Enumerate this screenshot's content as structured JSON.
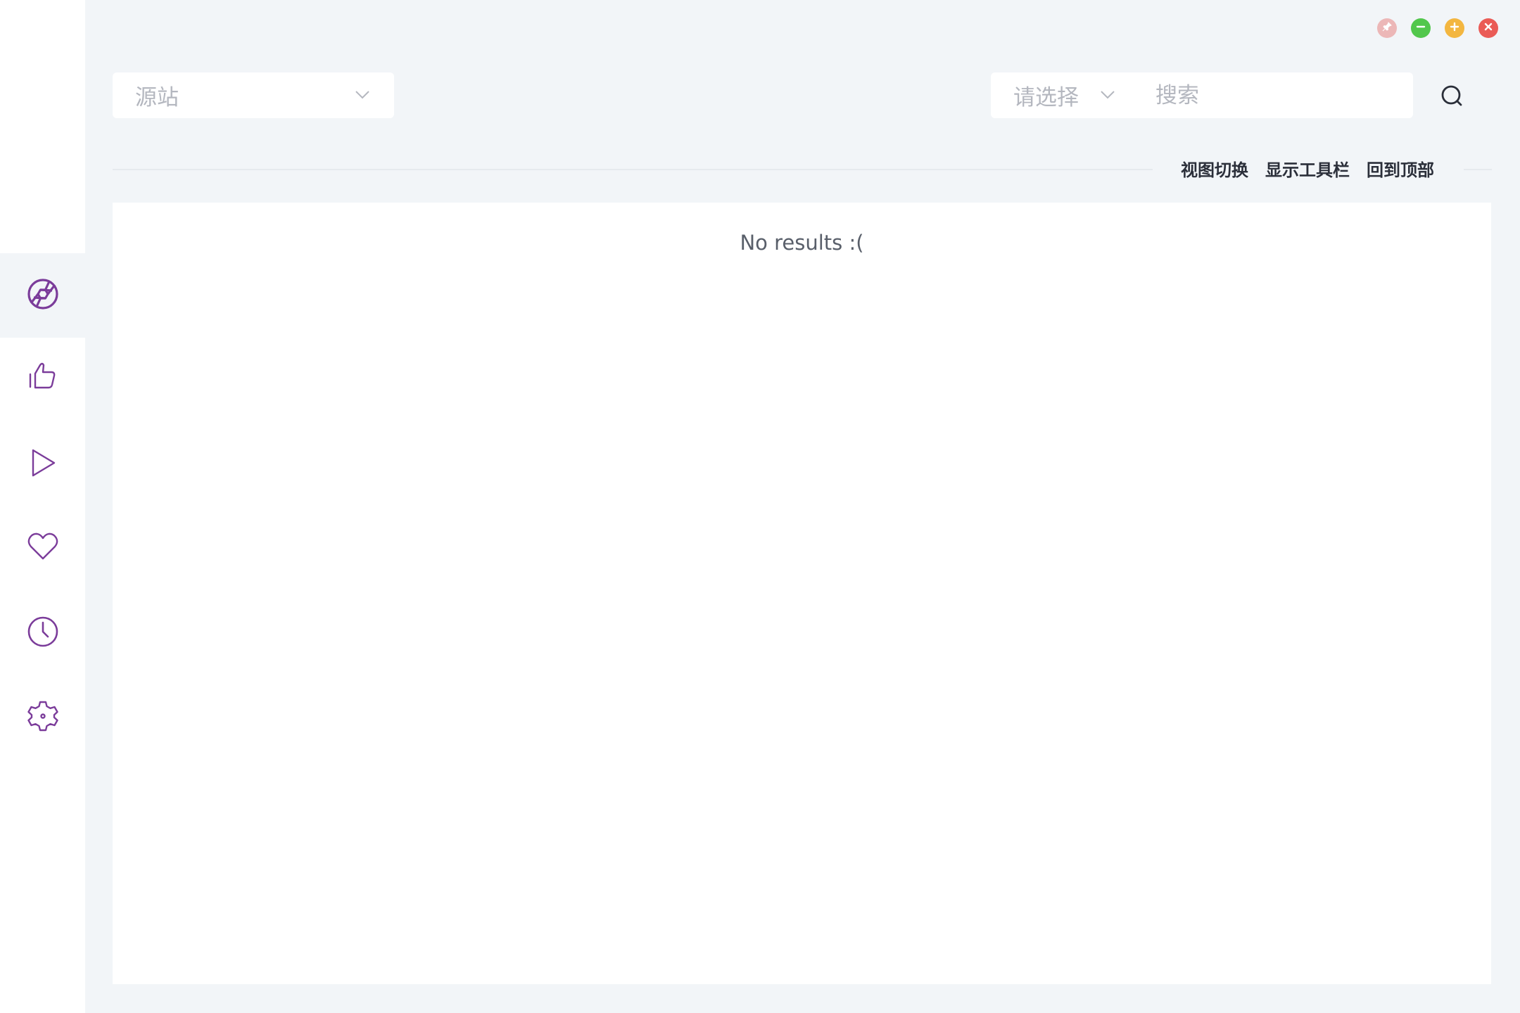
{
  "window_controls": {
    "pin_icon": "pin-icon",
    "minimize_icon": "minimize-icon",
    "maximize_icon": "maximize-icon",
    "close_icon": "close-icon"
  },
  "sidebar": {
    "items": [
      {
        "icon": "aperture-icon",
        "active": true
      },
      {
        "icon": "thumbs-up-icon",
        "active": false
      },
      {
        "icon": "play-icon",
        "active": false
      },
      {
        "icon": "heart-icon",
        "active": false
      },
      {
        "icon": "clock-icon",
        "active": false
      },
      {
        "icon": "gear-icon",
        "active": false
      }
    ],
    "accent_color": "#7b3c9a"
  },
  "source_select": {
    "placeholder": "源站"
  },
  "search": {
    "type_placeholder": "请选择",
    "input_placeholder": "搜索",
    "input_value": ""
  },
  "toolbar": {
    "view_switch": "视图切换",
    "show_toolbar": "显示工具栏",
    "back_to_top": "回到顶部"
  },
  "content": {
    "empty_message": "No results :("
  }
}
